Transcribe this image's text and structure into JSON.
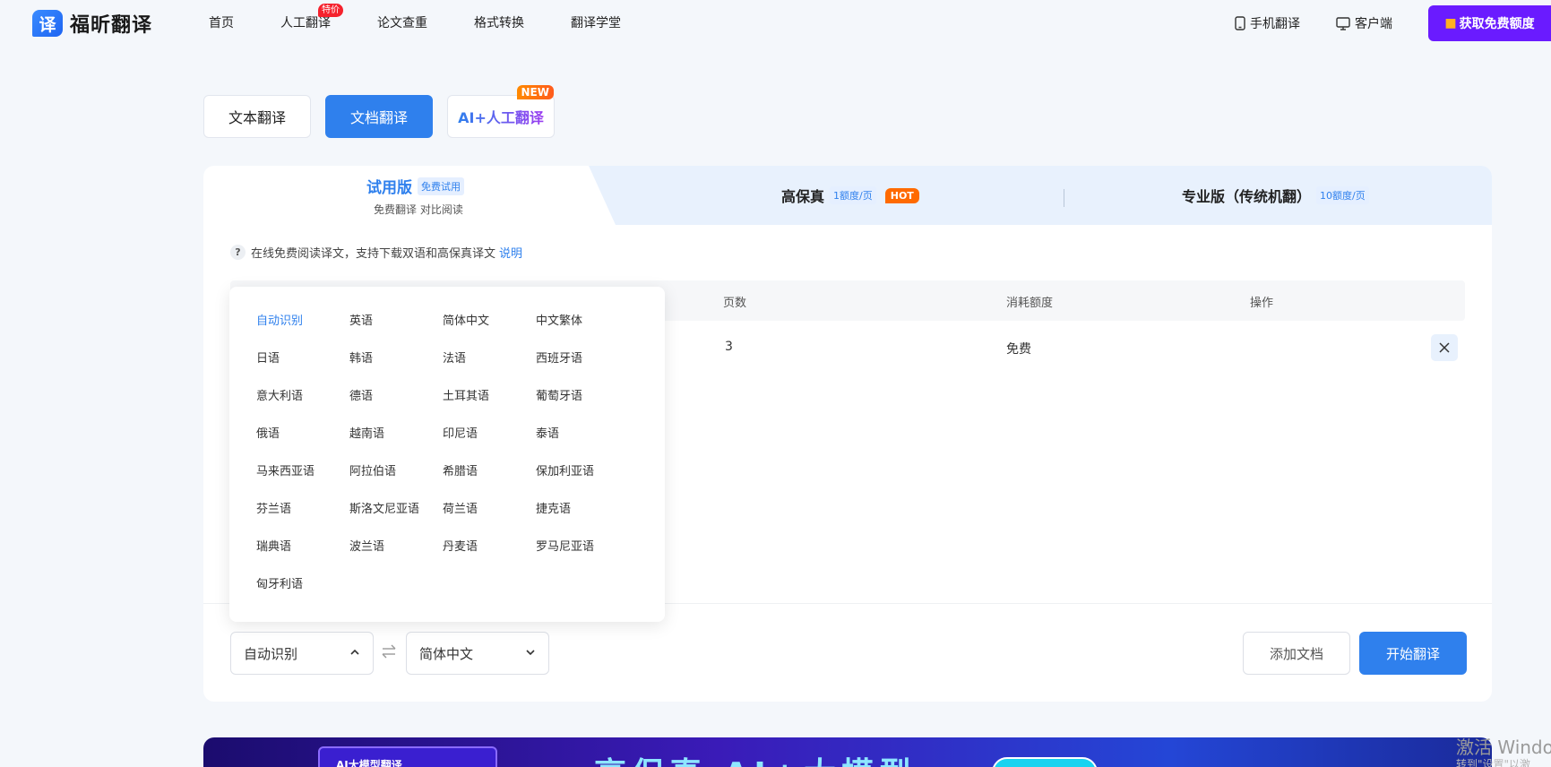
{
  "header": {
    "logo_mark": "译",
    "logo_text": "福昕翻译",
    "nav": [
      {
        "label": "首页"
      },
      {
        "label": "人工翻译",
        "badge": "特价"
      },
      {
        "label": "论文查重"
      },
      {
        "label": "格式转换"
      },
      {
        "label": "翻译学堂"
      }
    ],
    "mobile_label": "手机翻译",
    "client_label": "客户端",
    "free_button_label": "获取免费额度"
  },
  "mode_tabs": [
    {
      "label": "文本翻译",
      "active": false
    },
    {
      "label": "文档翻译",
      "active": true
    },
    {
      "label": "AI+人工翻译",
      "badge": "NEW",
      "active": false
    }
  ],
  "plans": {
    "trial": {
      "name": "试用版",
      "tag": "免费试用",
      "sub": "免费翻译 对比阅读"
    },
    "hifi": {
      "name": "高保真",
      "tag": "1额度/页",
      "badge": "HOT"
    },
    "pro": {
      "name": "专业版（传统机翻）",
      "tag": "10额度/页"
    }
  },
  "hint": {
    "text": "在线免费阅读译文，支持下载双语和高保真译文",
    "link": "说明",
    "icon": "?"
  },
  "table": {
    "headers": [
      "页数",
      "消耗额度",
      "操作"
    ],
    "rows": [
      {
        "pages": "3",
        "cost": "免费"
      }
    ]
  },
  "languages": [
    "自动识别",
    "英语",
    "简体中文",
    "中文繁体",
    "日语",
    "韩语",
    "法语",
    "西班牙语",
    "意大利语",
    "德语",
    "土耳其语",
    "葡萄牙语",
    "俄语",
    "越南语",
    "印尼语",
    "泰语",
    "马来西亚语",
    "阿拉伯语",
    "希腊语",
    "保加利亚语",
    "芬兰语",
    "斯洛文尼亚语",
    "荷兰语",
    "捷克语",
    "瑞典语",
    "波兰语",
    "丹麦语",
    "罗马尼亚语",
    "匈牙利语"
  ],
  "active_language": "自动识别",
  "controls": {
    "source_lang": "自动识别",
    "target_lang": "简体中文",
    "add_doc_label": "添加文档",
    "start_label": "开始翻译"
  },
  "banner": {
    "left_label": "AI大模型翻译",
    "title": "高保真 AI+大模型"
  },
  "watermark": {
    "line1": "激活 Windo",
    "line2": "转到\"设置\"以激"
  },
  "colors": {
    "primary": "#2f80ed",
    "free_button": "#6a1bff",
    "hot": "#ff6a00",
    "nav_badge": "#f5222d"
  }
}
